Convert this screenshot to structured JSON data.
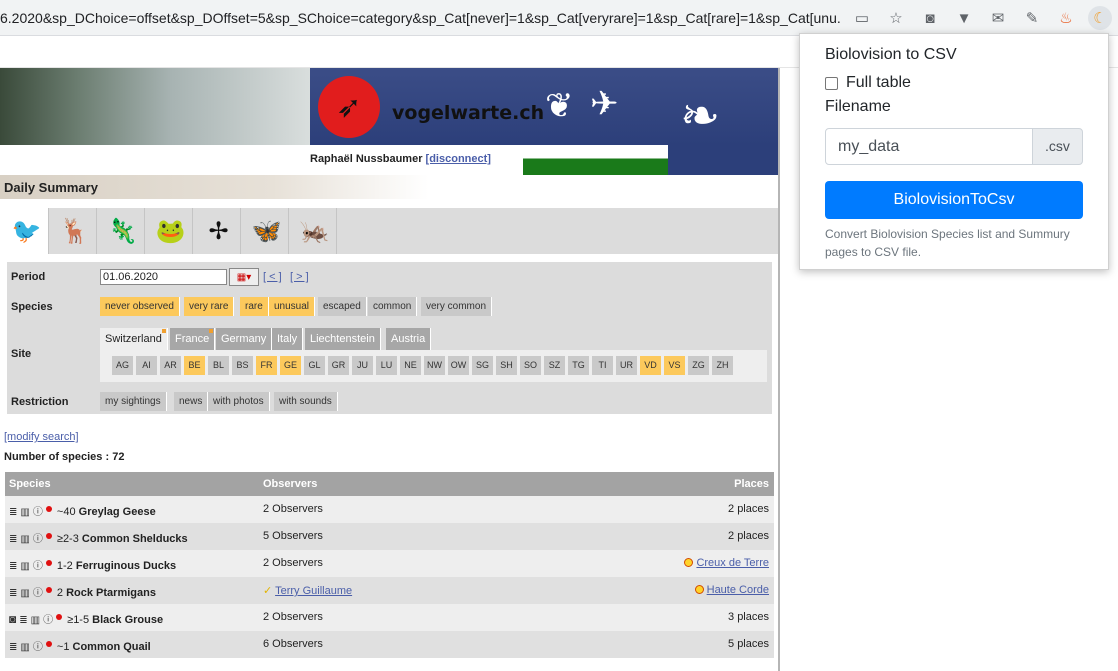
{
  "browser": {
    "url": "6.2020&sp_DChoice=offset&sp_DOffset=5&sp_SChoice=category&sp_Cat[never]=1&sp_Cat[veryrare]=1&sp_Cat[rare]=1&sp_Cat[unu..."
  },
  "banner": {
    "logo_text": "vogelwarte.ch",
    "user_name": "Raphaël Nussbaumer",
    "disconnect_label": "[disconnect]"
  },
  "daily_summary": {
    "title": "Daily Summary"
  },
  "filters": {
    "period_label": "Period",
    "date_value": "01.06.2020",
    "prev_label": "[ < ]",
    "next_label": "[ > ]",
    "species_label": "Species",
    "species_chips": [
      {
        "label": "never observed",
        "active": true
      },
      {
        "label": "very rare",
        "active": true
      },
      {
        "label": "rare",
        "active": true
      },
      {
        "label": "unusual",
        "active": true
      },
      {
        "label": "escaped",
        "active": false
      },
      {
        "label": "common",
        "active": false
      },
      {
        "label": "very common",
        "active": false
      }
    ],
    "site_label": "Site",
    "countries": [
      "Switzerland",
      "France",
      "Germany",
      "Italy",
      "Liechtenstein",
      "Austria"
    ],
    "cantons": [
      "AG",
      "AI",
      "AR",
      "BE",
      "BL",
      "BS",
      "FR",
      "GE",
      "GL",
      "GR",
      "JU",
      "LU",
      "NE",
      "NW",
      "OW",
      "SG",
      "SH",
      "SO",
      "SZ",
      "TG",
      "TI",
      "UR",
      "VD",
      "VS",
      "ZG",
      "ZH"
    ],
    "cantons_active": [
      "BE",
      "FR",
      "GE",
      "VD",
      "VS"
    ],
    "restriction_label": "Restriction",
    "restriction_chips": [
      "my sightings",
      "news",
      "with photos",
      "with sounds"
    ]
  },
  "modify_search": "[modify search]",
  "number_of_species": "Number of species : 72",
  "table": {
    "headers": {
      "species": "Species",
      "observers": "Observers",
      "places": "Places"
    },
    "rows": [
      {
        "count": "~40",
        "name": "Greylag Geese",
        "observers": "2 Observers",
        "places": "2 places"
      },
      {
        "count": "≥2-3",
        "name": "Common Shelducks",
        "observers": "5 Observers",
        "places": "2 places"
      },
      {
        "count": "1-2",
        "name": "Ferruginous Ducks",
        "observers": "2 Observers",
        "places": "Creux de Terre"
      },
      {
        "count": "2",
        "name": "Rock Ptarmigans",
        "observers": "Terry Guillaume",
        "places": "Haute Corde"
      },
      {
        "count": "≥1-5",
        "name": "Black Grouse",
        "observers": "2 Observers",
        "places": "3 places"
      },
      {
        "count": "~1",
        "name": "Common Quail",
        "observers": "6 Observers",
        "places": "5 places"
      }
    ]
  },
  "popup": {
    "title": "Biolovision to CSV",
    "full_table_label": "Full table",
    "filename_label": "Filename",
    "filename_value": "my_data",
    "suffix": ".csv",
    "button_label": "BiolovisionToCsv",
    "help_text": "Convert Biolovision Species list and Summury pages to CSV file."
  }
}
